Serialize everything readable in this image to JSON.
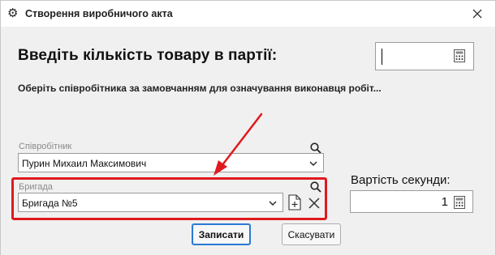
{
  "window": {
    "title": "Створення виробничого акта",
    "icon": "gear-icon",
    "close_icon": "close-icon"
  },
  "main": {
    "heading": "Введіть кількість товару в партії:",
    "instruction": "Оберіть співробітника за замовчанням для означування виконавця робіт...",
    "quantity_value": ""
  },
  "employee": {
    "label": "Співробітник",
    "value": "Пурин Михаил Максимович"
  },
  "brigade": {
    "label": "Бригада",
    "value": "Бригада №5"
  },
  "cost": {
    "label": "Вартість секунди:",
    "value": "1"
  },
  "buttons": {
    "save": "Записати",
    "cancel": "Скасувати"
  },
  "colors": {
    "highlight": "#e0191d",
    "primary_border": "#2a7ad4"
  }
}
